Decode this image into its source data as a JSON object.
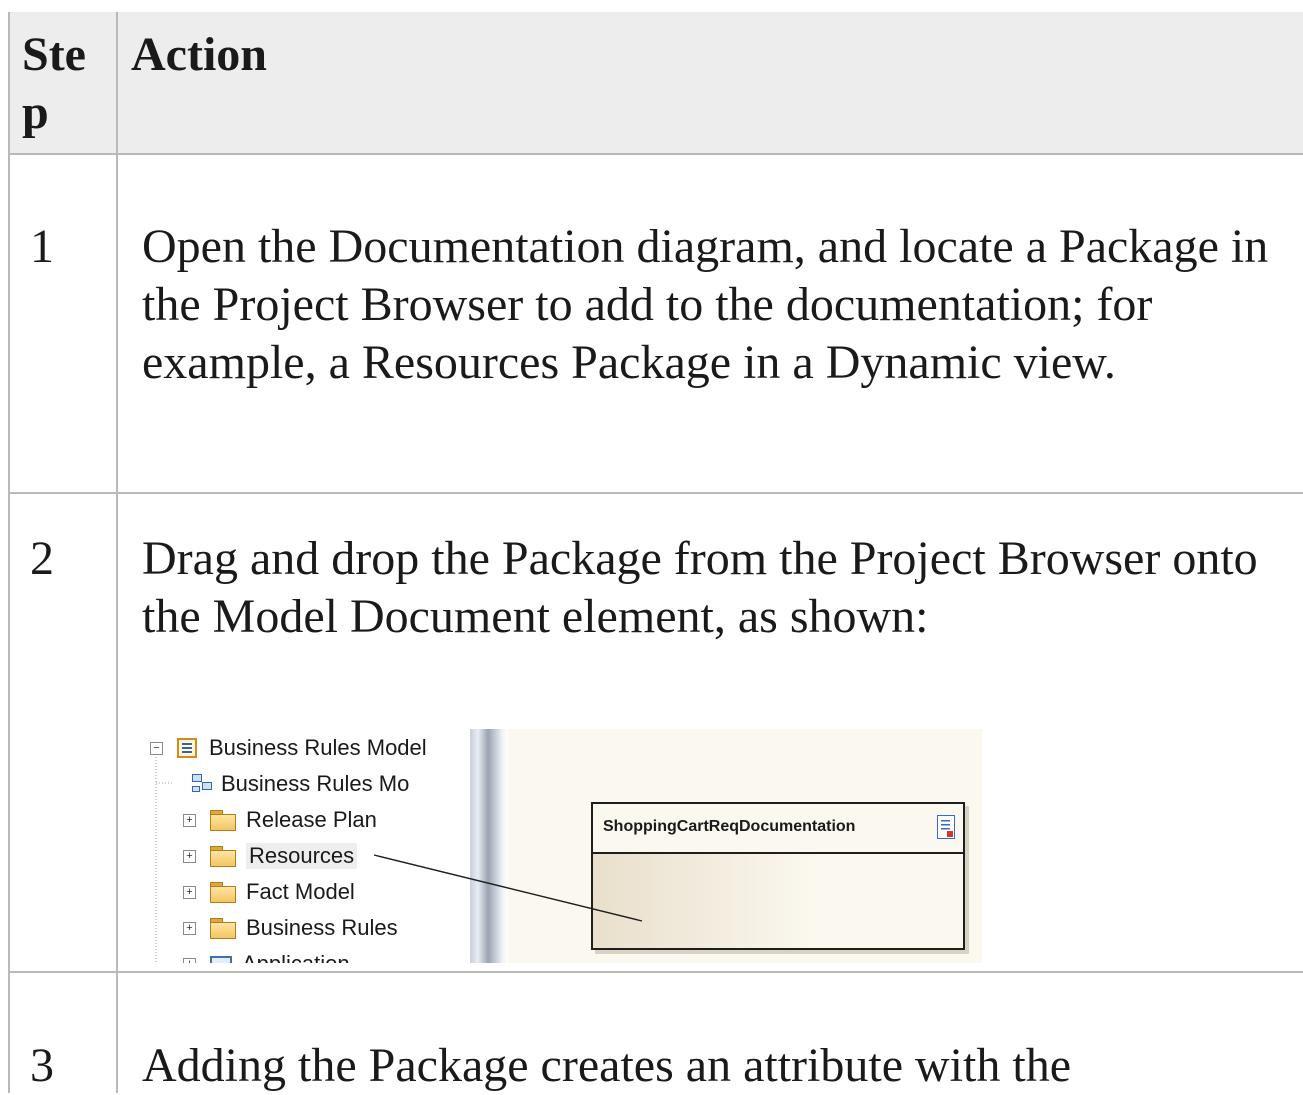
{
  "table": {
    "headers": {
      "step": "Ste p",
      "action": "Action"
    },
    "rows": [
      {
        "step": "1",
        "action": "Open the Documentation diagram, and locate a Package in the Project Browser to add to the documentation; for example, a Resources Package in a Dynamic view."
      },
      {
        "step": "2",
        "action": "Drag and drop the Package from the Project Browser onto the Model Document element, as shown:"
      },
      {
        "step": "3",
        "action": "Adding the Package creates an attribute with the"
      }
    ]
  },
  "screenshot": {
    "tree_items": [
      {
        "label": "Business Rules Model",
        "icon": "model-package-icon",
        "expander": "minus"
      },
      {
        "label": "Business Rules Mo",
        "icon": "diagram-icon",
        "expander": "none"
      },
      {
        "label": "Release Plan",
        "icon": "folder-icon",
        "expander": "plus"
      },
      {
        "label": "Resources",
        "icon": "folder-icon",
        "expander": "plus",
        "selected": true
      },
      {
        "label": "Fact Model",
        "icon": "folder-icon",
        "expander": "plus"
      },
      {
        "label": "Business Rules",
        "icon": "folder-icon",
        "expander": "plus"
      },
      {
        "label": "Application",
        "icon": "application-icon",
        "expander": "plus"
      }
    ],
    "model_document_title": "ShoppingCartReqDocumentation"
  }
}
